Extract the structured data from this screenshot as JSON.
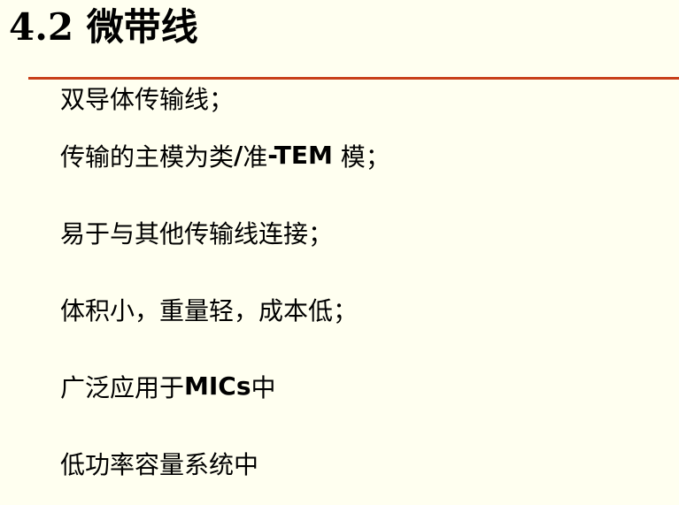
{
  "slide": {
    "title": "4.2 微带线",
    "accent_color": "#C8401A",
    "background_color": "#FFFFF0",
    "bullets": [
      {
        "parts": [
          "双导体传输线；"
        ]
      },
      {
        "parts": [
          "传输的主模为类",
          "/",
          "准",
          "-TEM",
          " 模；"
        ]
      },
      {
        "parts": [
          "易于与其他传输线连接；"
        ]
      },
      {
        "parts": [
          "体积小，重量轻，成本低；"
        ]
      },
      {
        "parts": [
          "广泛应用于",
          "MICs",
          "中"
        ]
      },
      {
        "parts": [
          "低功率容量系统中"
        ]
      }
    ]
  }
}
